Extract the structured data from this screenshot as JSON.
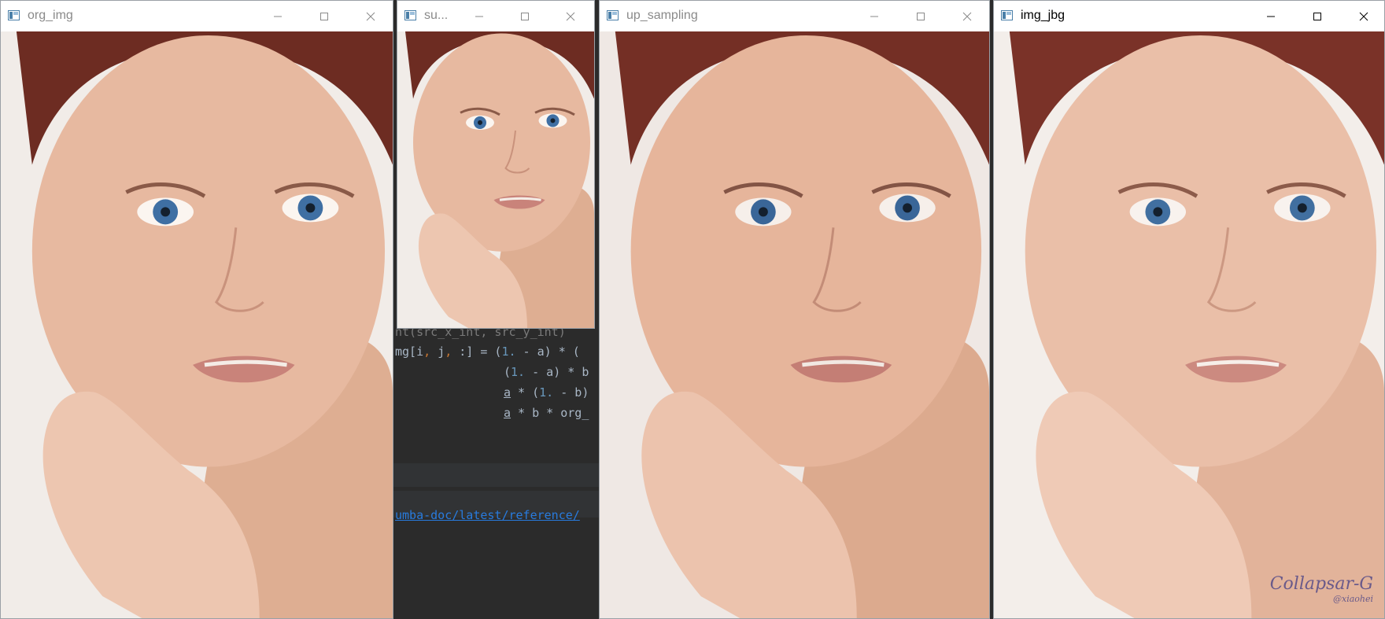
{
  "windows": [
    {
      "id": "org_img",
      "title": "org_img"
    },
    {
      "id": "sub",
      "title": "su..."
    },
    {
      "id": "up_sampling",
      "title": "up_sampling"
    },
    {
      "id": "img_jbg",
      "title": "img_jbg"
    }
  ],
  "code": {
    "line1": "nt(src_x_int, src_y_int)",
    "line2": {
      "a": "mg[i",
      "b": ", ",
      "c": "j",
      "d": ", ",
      "e": ":] = (",
      "f": "1.",
      "g": " - a) * ("
    },
    "line3": {
      "a": "(",
      "b": "1.",
      "c": " - a) * b"
    },
    "line4": {
      "a": "a",
      "b": " * (",
      "c": "1.",
      "d": " - b)"
    },
    "line5": {
      "a": "a",
      "b": " * b * org_"
    },
    "link": "umba-doc/latest/reference/"
  },
  "watermark": {
    "line1": "Collapsar-G",
    "line2": "@xiaohei"
  },
  "colors": {
    "skin": "#e7b9a0",
    "hair": "#6d2c22",
    "eye": "#3f6fa3",
    "lip": "#c9837a",
    "ide_bg": "#2b2b2b"
  }
}
